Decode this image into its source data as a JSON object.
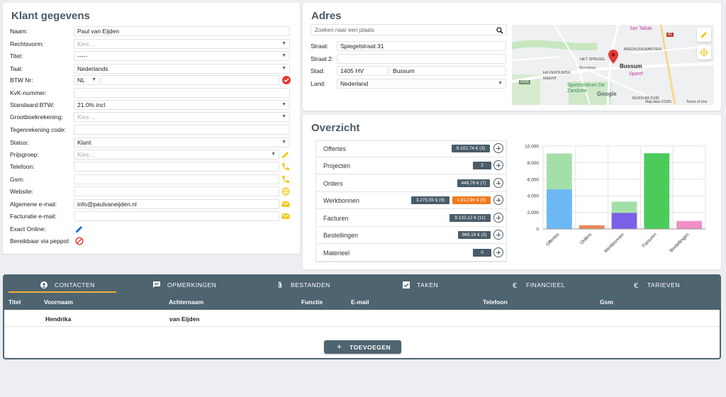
{
  "klant": {
    "title": "Klant gegevens",
    "fields": [
      {
        "label": "Naam:",
        "value": "Paul van Eijden"
      },
      {
        "label": "Rechtsvorm:",
        "value": "Kies ..."
      },
      {
        "label": "Titel:",
        "value": "-----"
      },
      {
        "label": "Taal:",
        "value": "Nederlands"
      },
      {
        "label": "BTW Nr:",
        "value": "NL"
      },
      {
        "label": "KvK-nummer:",
        "value": ""
      },
      {
        "label": "Standaard BTW:",
        "value": "21.0% incl"
      },
      {
        "label": "Grootboekrekening:",
        "value": "Kies ..."
      },
      {
        "label": "Tegenrekening code:",
        "value": ""
      },
      {
        "label": "Status:",
        "value": "Klant"
      },
      {
        "label": "Prijsgroep:",
        "value": "Kies ..."
      },
      {
        "label": "Telefoon:",
        "value": ""
      },
      {
        "label": "Gsm:",
        "value": ""
      },
      {
        "label": "Website:",
        "value": ""
      },
      {
        "label": "Algemene e-mail:",
        "value": "info@paulvaneijden.nl"
      },
      {
        "label": "Facturatie e-mail:",
        "value": ""
      },
      {
        "label": "Exact Online:",
        "value": ""
      },
      {
        "label": "Bereikbaar via peppol:",
        "value": ""
      }
    ]
  },
  "adres": {
    "title": "Adres",
    "search_placeholder": "Zoeken naar een plaats",
    "straat_label": "Straat:",
    "straat_value": "Spiegelstraat 31",
    "straat2_label": "Straat 2:",
    "straat2_value": "",
    "stad_label": "Stad:",
    "postcode": "1405 HV",
    "stad_value": "Bussum",
    "land_label": "Land:",
    "land_value": "Nederland",
    "map": {
      "labels": [
        "Jan Tabak",
        "HET SPIEGEL",
        "BREDIUSKWARTIER",
        "Bussum",
        "HILVERSUMSE MEENT",
        "Meentweg",
        "Spant!",
        "Sportcentrum De Zandzee",
        "BUSSUM ZUID",
        "N236",
        "A1"
      ],
      "google": "Google",
      "mapdata": "Map data ©2025",
      "terms": "Terms of Use"
    }
  },
  "overzicht": {
    "title": "Overzicht",
    "rows": [
      {
        "label": "Offertes",
        "badges": [
          "9.102,74 € (3)"
        ]
      },
      {
        "label": "Projecten",
        "badges": [
          "2"
        ]
      },
      {
        "label": "Orders",
        "badges": [
          "448,76 € (7)"
        ]
      },
      {
        "label": "Werkbonnen",
        "badges": [
          "3.275,55 € (9)",
          "1.912,94 € (9)"
        ]
      },
      {
        "label": "Facturen",
        "badges": [
          "9.132,12 € (11)"
        ]
      },
      {
        "label": "Bestellingen",
        "badges": [
          "969,19 € (3)"
        ]
      },
      {
        "label": "Materieel",
        "badges": [
          "0"
        ]
      }
    ]
  },
  "chart_data": {
    "type": "bar",
    "categories": [
      "Offertes",
      "Orders",
      "Werkbonnen",
      "Facturen",
      "Bestellingen"
    ],
    "series": [
      {
        "values": [
          4800,
          450,
          1950,
          9130,
          0
        ],
        "color": "#6cb8f5"
      },
      {
        "values": [
          4300,
          0,
          1350,
          0,
          970
        ],
        "color": "#a3e0a8"
      }
    ],
    "bar_colors_primary": [
      "#6cb8f5",
      "#e8875a",
      "#7b5fe6",
      "#4ccb5a",
      "#ef8fc6"
    ],
    "ylim": [
      0,
      10000
    ],
    "yticks": [
      "0",
      "2.000",
      "4.000",
      "6.000",
      "8.000",
      "10.000"
    ],
    "grid": true
  },
  "tabs": [
    {
      "label": "CONTACTEN",
      "icon": "person-icon"
    },
    {
      "label": "OPMERKINGEN",
      "icon": "comment-icon"
    },
    {
      "label": "BESTANDEN",
      "icon": "paperclip-icon"
    },
    {
      "label": "TAKEN",
      "icon": "checkbox-icon"
    },
    {
      "label": "FINANCIEEL",
      "icon": "euro-icon"
    },
    {
      "label": "TARIEVEN",
      "icon": "euro-icon"
    }
  ],
  "table": {
    "columns": [
      "Titel",
      "Voornaam",
      "Achternaam",
      "Functie",
      "E-mail",
      "Telefoon",
      "Gsm"
    ],
    "rows": [
      {
        "titel": "",
        "voornaam": "Hendrika",
        "achternaam": "van Eijden",
        "functie": "",
        "email": "",
        "telefoon": "",
        "gsm": ""
      }
    ],
    "add_label": "TOEVOEGEN"
  },
  "colors": {
    "accent": "#4e6470",
    "tab_active": "#f2b134",
    "edit": "#f2c81d",
    "phone": "#f2c81d",
    "check": "#e53935",
    "ban": "#e53935",
    "pencil_blue": "#1e6fd9"
  }
}
